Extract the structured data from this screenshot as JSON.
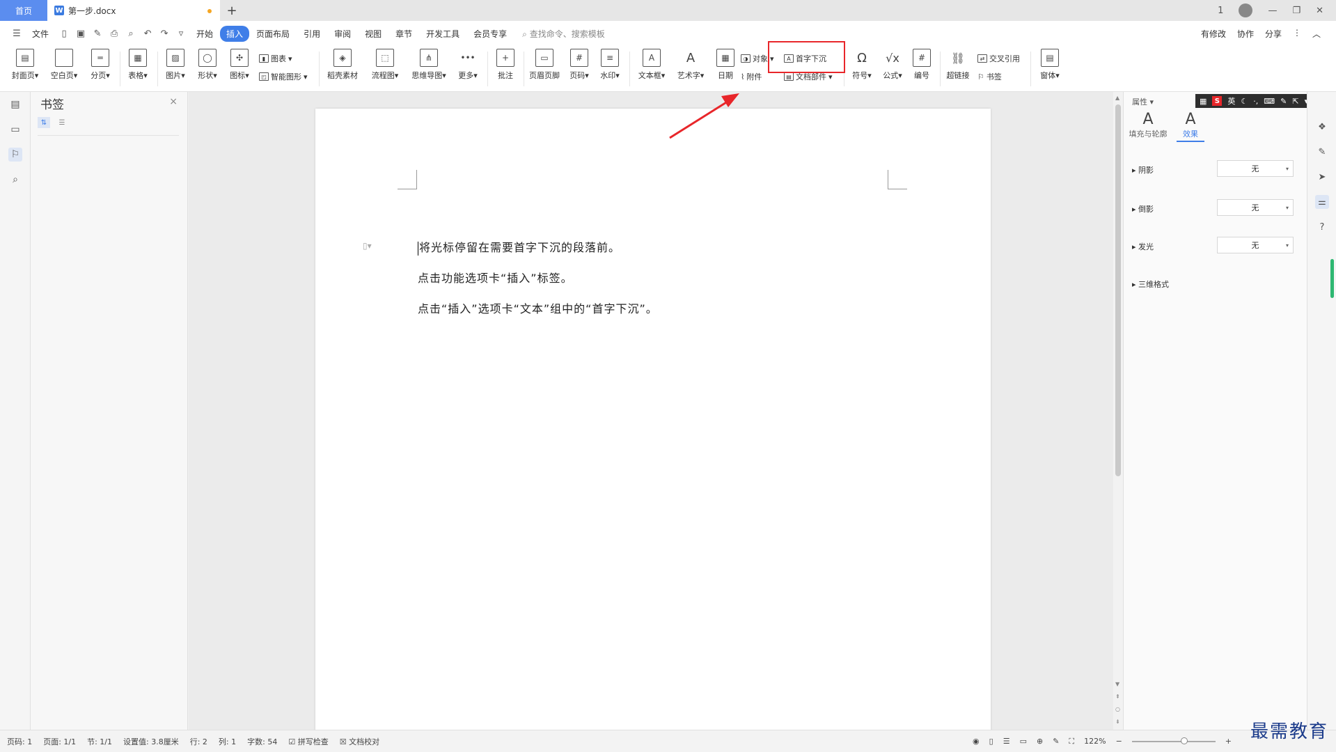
{
  "titlebar": {
    "home_tab": "首页",
    "doc_tab": "第一步.docx",
    "doc_icon_letter": "W",
    "add_tab": "+",
    "right_icons": [
      "1",
      "—",
      "❐",
      "✕"
    ]
  },
  "menubar": {
    "file": "文件",
    "tabs": [
      "开始",
      "插入",
      "页面布局",
      "引用",
      "审阅",
      "视图",
      "章节",
      "开发工具",
      "会员专享"
    ],
    "active_tab": "插入",
    "search": "查找命令、搜索模板",
    "right": [
      "有修改",
      "协作",
      "分享"
    ]
  },
  "ribbon": {
    "cover": "封面页",
    "blank": "空白页",
    "pagebreak": "分页",
    "table": "表格",
    "picture": "图片",
    "shape": "形状",
    "icon": "图标",
    "chart": "图表",
    "smartart": "智能图形",
    "docer": "稻壳素材",
    "flow": "流程图",
    "mindmap": "思维导图",
    "more": "更多",
    "comment": "批注",
    "headerfooter": "页眉页脚",
    "pagenum": "页码",
    "watermark": "水印",
    "textbox": "文本框",
    "wordart": "艺术字",
    "date": "日期",
    "object": "对象",
    "attach": "附件",
    "dropcap": "首字下沉",
    "docpart": "文档部件",
    "symbol": "符号",
    "formula": "公式",
    "numbering": "编号",
    "hyperlink": "超链接",
    "crossref": "交叉引用",
    "bookmark": "书签",
    "window": "窗体"
  },
  "bookmark_panel": {
    "title": "书签",
    "close": "×"
  },
  "document": {
    "paragraphs": [
      "将光标停留在需要首字下沉的段落前。",
      "点击功能选项卡“插入”标签。",
      "点击“插入”选项卡“文本”组中的“首字下沉”。"
    ]
  },
  "properties": {
    "header": "属性",
    "tab_fill": "填充与轮廓",
    "tab_effect": "效果",
    "rows": [
      {
        "label": "阴影",
        "value": "无"
      },
      {
        "label": "倒影",
        "value": "无"
      },
      {
        "label": "发光",
        "value": "无"
      },
      {
        "label": "三维格式",
        "value": ""
      }
    ],
    "ime": "英"
  },
  "statusbar": {
    "page": "页码: 1",
    "pages": "页面: 1/1",
    "section": "节: 1/1",
    "setting": "设置值: 3.8厘米",
    "row": "行: 2",
    "col": "列: 1",
    "words": "字数: 54",
    "spell": "拼写检查",
    "proof": "文档校对",
    "zoom": "122%"
  },
  "watermark": "最需教育",
  "colors": {
    "accent": "#3f7ee8",
    "highlight_box": "#e8262a",
    "arrow": "#e8262a",
    "watermark": "#1a3a8a"
  }
}
